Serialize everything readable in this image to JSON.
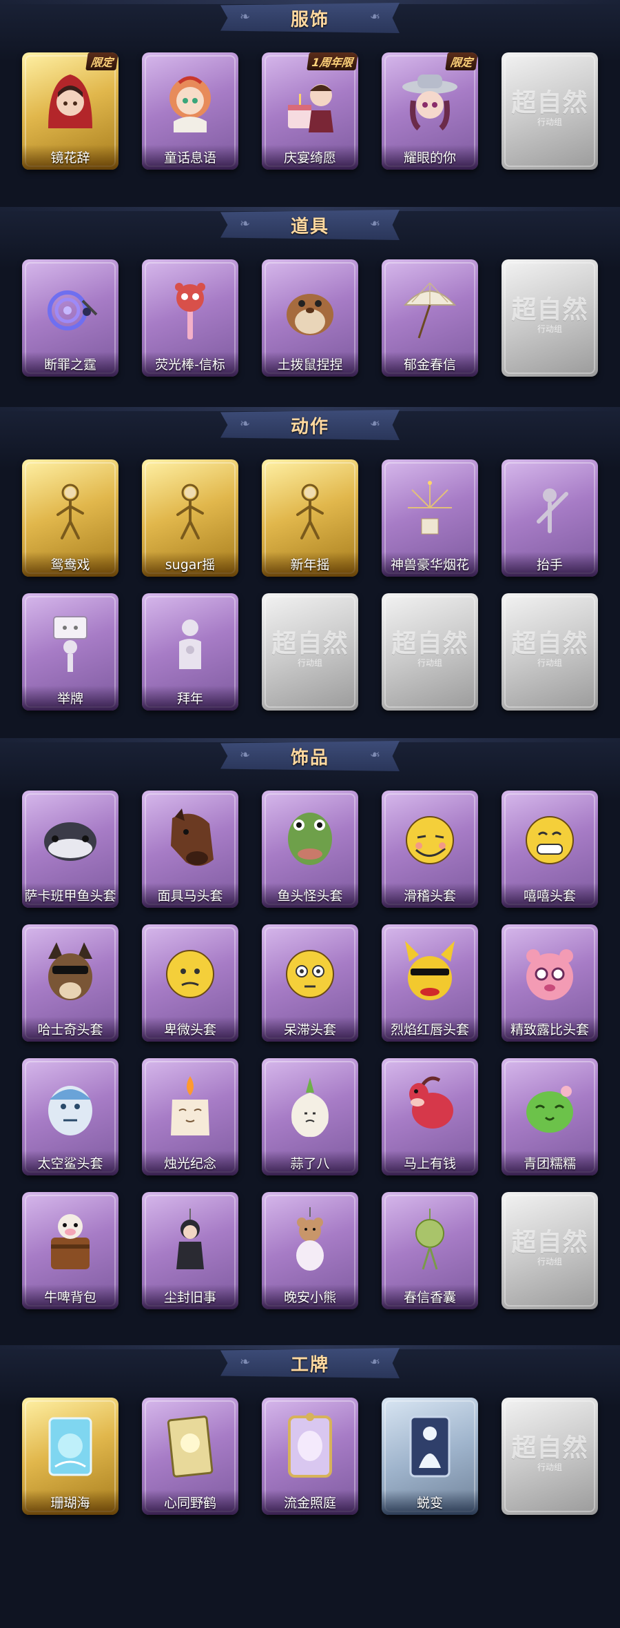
{
  "sections": [
    {
      "title": "服饰",
      "items": [
        {
          "label": "镜花辞",
          "badge": "限定",
          "style": "gold",
          "icon": "red-hood-girl-icon"
        },
        {
          "label": "童话息语",
          "badge": "",
          "style": "purple",
          "icon": "fairy-tale-girl-icon"
        },
        {
          "label": "庆宴绮愿",
          "badge": "1周年限",
          "style": "purple",
          "icon": "celebration-cake-girl-icon"
        },
        {
          "label": "耀眼的你",
          "badge": "限定",
          "style": "purple",
          "icon": "cowboy-hat-girl-icon"
        },
        {
          "label": "",
          "badge": "",
          "style": "gray",
          "icon": "placeholder-icon",
          "placeholder": "超自然",
          "placeholder_sub": "行动组"
        }
      ]
    },
    {
      "title": "道具",
      "items": [
        {
          "label": "断罪之霆",
          "style": "purple",
          "icon": "lightning-spiral-icon"
        },
        {
          "label": "荧光棒-信标",
          "style": "purple",
          "icon": "panda-glowstick-icon"
        },
        {
          "label": "土拨鼠捏捏",
          "style": "purple",
          "icon": "groundhog-icon"
        },
        {
          "label": "郁金春信",
          "style": "purple",
          "icon": "parasol-icon"
        },
        {
          "label": "",
          "style": "gray",
          "icon": "placeholder-icon",
          "placeholder": "超自然",
          "placeholder_sub": "行动组"
        }
      ]
    },
    {
      "title": "动作",
      "items": [
        {
          "label": "鸳鸯戏",
          "style": "gold",
          "icon": "dance-pose-icon"
        },
        {
          "label": "sugar摇",
          "style": "gold",
          "icon": "sway-pose-icon"
        },
        {
          "label": "新年摇",
          "style": "gold",
          "icon": "newyear-pose-icon"
        },
        {
          "label": "神兽豪华烟花",
          "style": "purple",
          "icon": "fireworks-icon"
        },
        {
          "label": "抬手",
          "style": "purple",
          "icon": "raise-hand-icon"
        },
        {
          "label": "举牌",
          "style": "purple",
          "icon": "hold-sign-icon"
        },
        {
          "label": "拜年",
          "style": "purple",
          "icon": "bow-greeting-icon"
        },
        {
          "label": "",
          "style": "gray",
          "icon": "placeholder-icon",
          "placeholder": "超自然",
          "placeholder_sub": "行动组"
        },
        {
          "label": "",
          "style": "gray",
          "icon": "placeholder-icon",
          "placeholder": "超自然",
          "placeholder_sub": "行动组"
        },
        {
          "label": "",
          "style": "gray",
          "icon": "placeholder-icon",
          "placeholder": "超自然",
          "placeholder_sub": "行动组"
        }
      ]
    },
    {
      "title": "饰品",
      "items": [
        {
          "label": "萨卡班甲鱼头套",
          "style": "purple",
          "icon": "fish-mask-icon"
        },
        {
          "label": "面具马头套",
          "style": "purple",
          "icon": "horse-mask-icon"
        },
        {
          "label": "鱼头怪头套",
          "style": "purple",
          "icon": "fishhead-mask-icon"
        },
        {
          "label": "滑稽头套",
          "style": "purple",
          "icon": "funny-face-icon"
        },
        {
          "label": "嘻嘻头套",
          "style": "purple",
          "icon": "grin-face-icon"
        },
        {
          "label": "哈士奇头套",
          "style": "purple",
          "icon": "husky-mask-icon"
        },
        {
          "label": "卑微头套",
          "style": "purple",
          "icon": "humble-face-icon"
        },
        {
          "label": "呆滞头套",
          "style": "purple",
          "icon": "stunned-face-icon"
        },
        {
          "label": "烈焰红唇头套",
          "style": "purple",
          "icon": "pikachu-mask-icon"
        },
        {
          "label": "精致露比头套",
          "style": "purple",
          "icon": "pink-bear-mask-icon"
        },
        {
          "label": "太空鲨头套",
          "style": "purple",
          "icon": "space-shark-icon"
        },
        {
          "label": "烛光纪念",
          "style": "purple",
          "icon": "candle-icon"
        },
        {
          "label": "蒜了八",
          "style": "purple",
          "icon": "garlic-icon"
        },
        {
          "label": "马上有钱",
          "style": "purple",
          "icon": "red-horse-icon"
        },
        {
          "label": "青团糯糯",
          "style": "purple",
          "icon": "green-dumpling-icon"
        },
        {
          "label": "牛啤背包",
          "style": "purple",
          "icon": "cow-beer-backpack-icon"
        },
        {
          "label": "尘封旧事",
          "style": "purple",
          "icon": "keychain-figure-icon"
        },
        {
          "label": "晚安小熊",
          "style": "purple",
          "icon": "teddy-bear-icon"
        },
        {
          "label": "春信香囊",
          "style": "purple",
          "icon": "sachet-icon"
        },
        {
          "label": "",
          "style": "gray",
          "icon": "placeholder-icon",
          "placeholder": "超自然",
          "placeholder_sub": "行动组"
        }
      ]
    },
    {
      "title": "工牌",
      "items": [
        {
          "label": "珊瑚海",
          "style": "gold",
          "icon": "coral-sea-card-icon"
        },
        {
          "label": "心同野鹤",
          "style": "purple",
          "icon": "crane-card-icon"
        },
        {
          "label": "流金照庭",
          "style": "purple",
          "icon": "gilded-card-icon"
        },
        {
          "label": "蜕变",
          "style": "blue",
          "icon": "silhouette-card-icon"
        },
        {
          "label": "",
          "style": "gray",
          "icon": "placeholder-icon",
          "placeholder": "超自然",
          "placeholder_sub": "行动组"
        }
      ]
    }
  ],
  "colors": {
    "background": "#0f1422",
    "banner": "#2a365a",
    "banner_text": "#ffd9a0",
    "purple_card": "#a77cc6",
    "gold_card": "#e1b74c",
    "gray_card": "#c9c9c9",
    "blue_card": "#9fb4cc"
  }
}
